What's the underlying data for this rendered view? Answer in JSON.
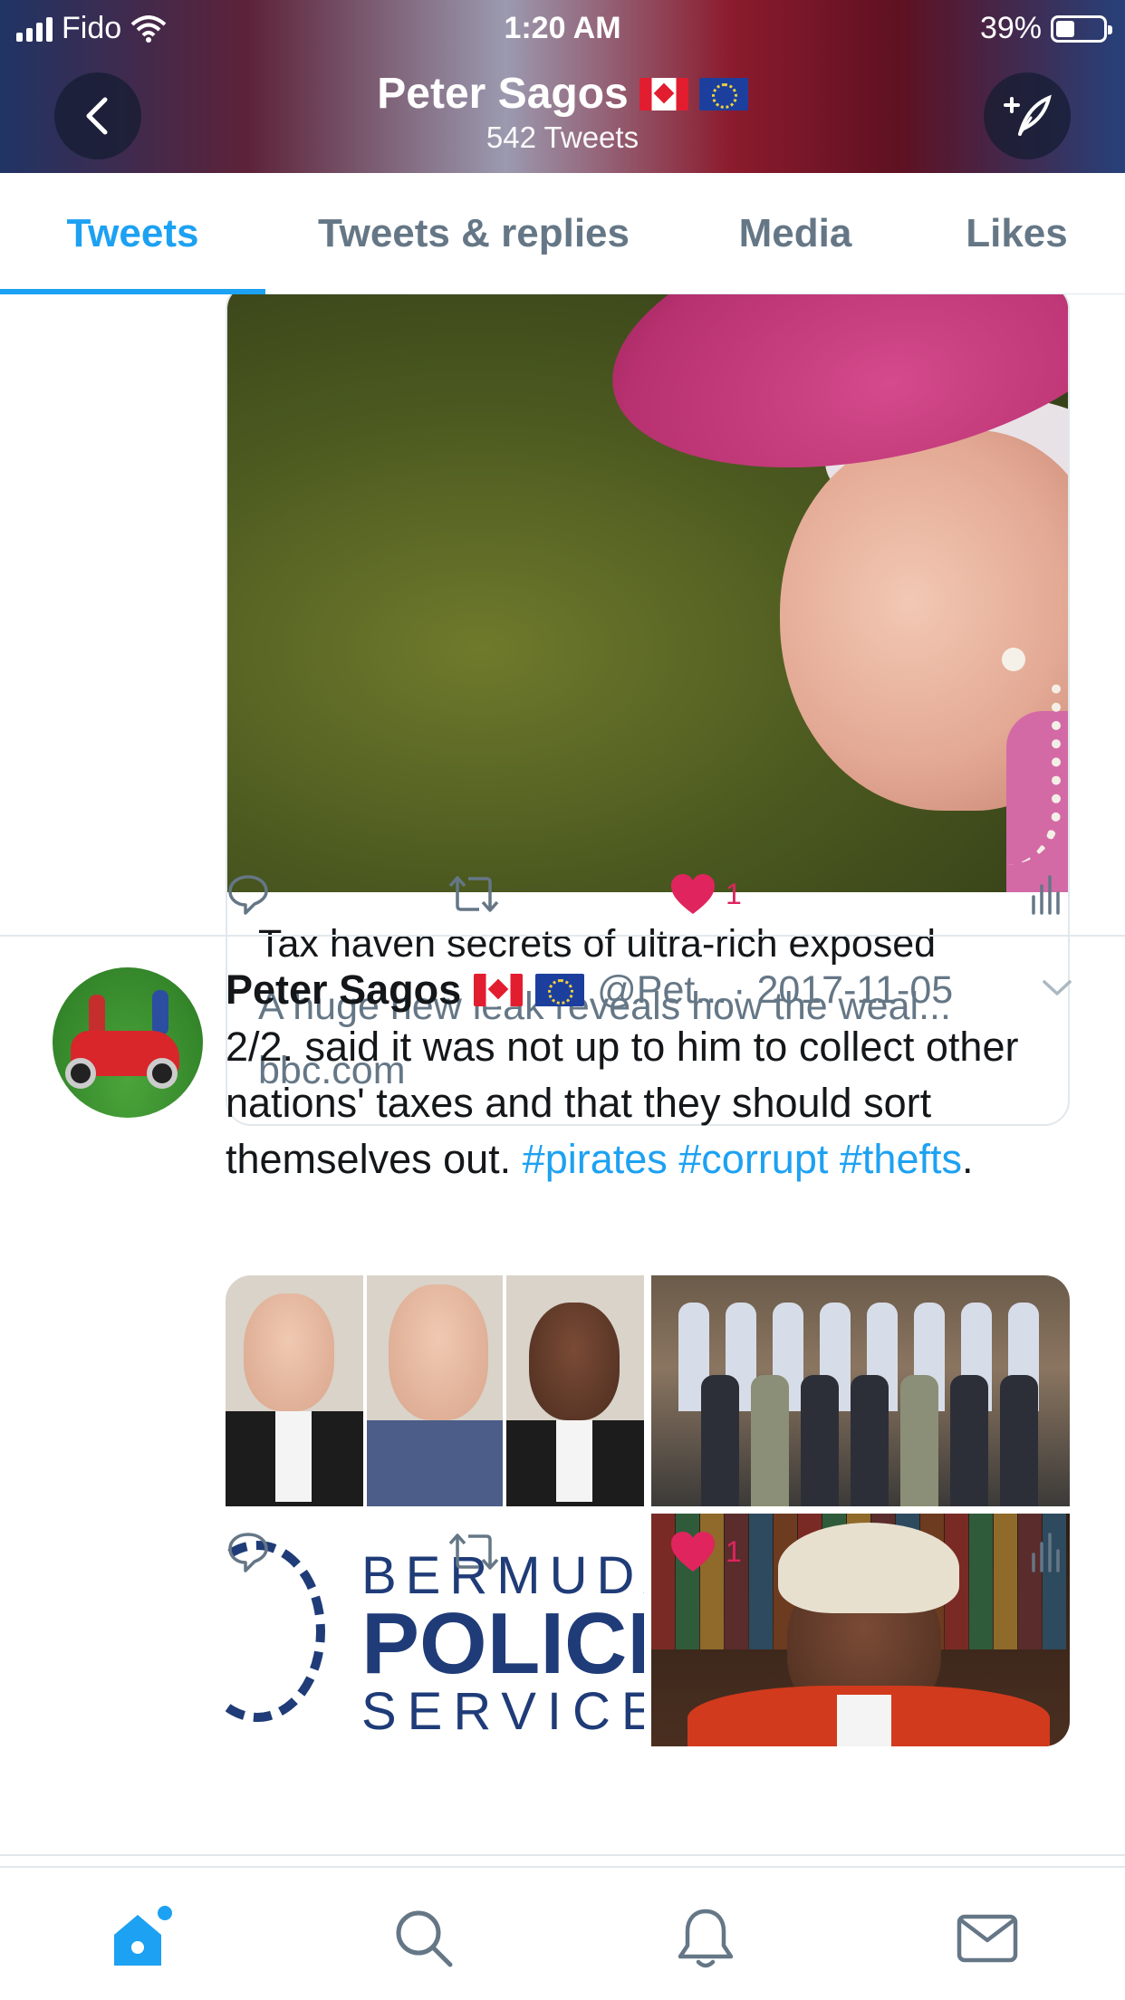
{
  "status_bar": {
    "carrier": "Fido",
    "time": "1:20 AM",
    "battery_percent": "39%",
    "battery_level": 0.39
  },
  "header": {
    "profile_name": "Peter Sagos",
    "tweet_count": "542 Tweets",
    "flags": [
      "canada-flag",
      "eu-flag"
    ]
  },
  "tabs": [
    {
      "label": "Tweets",
      "active": true
    },
    {
      "label": "Tweets & replies",
      "active": false
    },
    {
      "label": "Media",
      "active": false
    },
    {
      "label": "Likes",
      "active": false
    }
  ],
  "link_card": {
    "title": "Tax haven secrets of ultra-rich exposed",
    "description": "A huge new leak reveals how the weal...",
    "domain": "bbc.com"
  },
  "tweet1_actions": {
    "like_count": "1"
  },
  "tweet2": {
    "author_name": "Peter Sagos",
    "handle": "@Pet...",
    "date": "· 2017-11-05",
    "text_plain": "2/2. said it was not up to him to collect other nations' taxes and that they should sort themselves out.",
    "hashtags": [
      "#pirates",
      "#corrupt",
      "#thefts"
    ],
    "text_end": ".",
    "like_count": "1"
  },
  "media": {
    "police_logo": {
      "line1": "BERMUDA",
      "line2": "POLICE",
      "line3": "SERVICE"
    }
  },
  "bottom_nav": [
    {
      "icon": "home-icon",
      "active": true,
      "has_badge": true
    },
    {
      "icon": "search-icon",
      "active": false
    },
    {
      "icon": "bell-icon",
      "active": false
    },
    {
      "icon": "mail-icon",
      "active": false
    }
  ],
  "colors": {
    "accent": "#1da1f2",
    "like": "#e0245e",
    "secondary_text": "#657786",
    "border": "#e1e8ed"
  }
}
